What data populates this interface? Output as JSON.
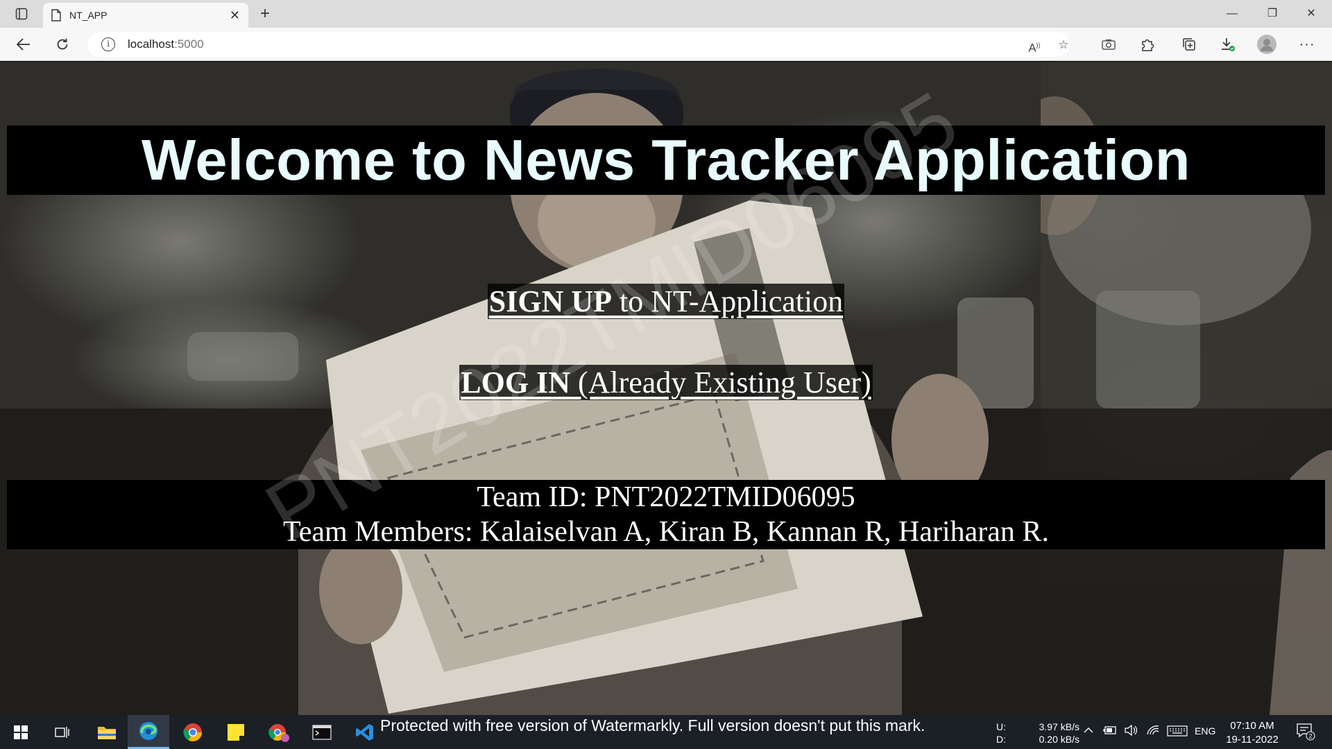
{
  "browser": {
    "tab_title": "NT_APP",
    "url_host": "localhost",
    "url_port": ":5000"
  },
  "page": {
    "welcome_title": "Welcome to News Tracker Application",
    "signup_strong": "SIGN UP",
    "signup_rest": " to NT-Application",
    "login_strong": "LOG IN",
    "login_rest": " (Already Existing User)",
    "team_id_line": "Team ID: PNT2022TMID06095",
    "team_members_line": "Team Members: Kalaiselvan A, Kiran B, Kannan R, Hariharan R.",
    "watermark_text": "PNT2022TMID06095"
  },
  "taskbar": {
    "watermark_note": "Protected with free version of Watermarkly. Full version doesn't put this mark.",
    "net_up_label": "U:",
    "net_down_label": "D:",
    "net_up_value": "3.97 kB/s",
    "net_down_value": "0.20 kB/s",
    "language": "ENG",
    "time": "07:10 AM",
    "date": "19-11-2022",
    "notification_count": "2"
  },
  "colors": {
    "banner_bg": "#000000",
    "title_text": "#e8fbff",
    "taskbar_bg": "#1b1f26"
  }
}
